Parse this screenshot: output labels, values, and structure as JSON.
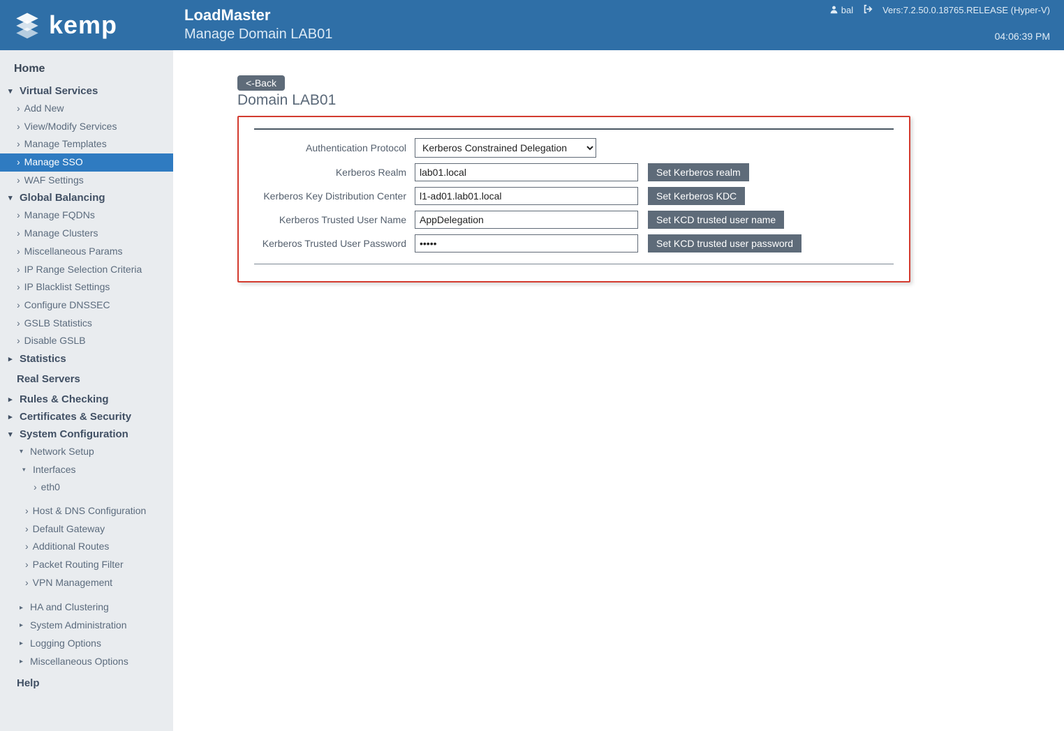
{
  "header": {
    "product": "LoadMaster",
    "subtitle": "Manage Domain LAB01",
    "user": "bal",
    "version": "Vers:7.2.50.0.18765.RELEASE (Hyper-V)",
    "clock": "04:06:39 PM",
    "logo_text": "kemp"
  },
  "sidebar": {
    "home": "Home",
    "virtual_services": {
      "label": "Virtual Services",
      "items": [
        "Add New",
        "View/Modify Services",
        "Manage Templates",
        "Manage SSO",
        "WAF Settings"
      ],
      "active_index": 3
    },
    "global_balancing": {
      "label": "Global Balancing",
      "items": [
        "Manage FQDNs",
        "Manage Clusters",
        "Miscellaneous Params",
        "IP Range Selection Criteria",
        "IP Blacklist Settings",
        "Configure DNSSEC",
        "GSLB Statistics",
        "Disable GSLB"
      ]
    },
    "statistics": "Statistics",
    "real_servers": "Real Servers",
    "rules_checking": "Rules & Checking",
    "certs_security": "Certificates & Security",
    "system_configuration": {
      "label": "System Configuration",
      "network_setup": {
        "label": "Network Setup",
        "interfaces": {
          "label": "Interfaces",
          "items": [
            "eth0"
          ]
        },
        "items": [
          "Host & DNS Configuration",
          "Default Gateway",
          "Additional Routes",
          "Packet Routing Filter",
          "VPN Management"
        ]
      },
      "collapsed": [
        "HA and Clustering",
        "System Administration",
        "Logging Options",
        "Miscellaneous Options"
      ]
    },
    "help": "Help"
  },
  "content": {
    "back_label": "<-Back",
    "domain_title": "Domain LAB01",
    "rows": {
      "auth_protocol": {
        "label": "Authentication Protocol",
        "value": "Kerberos Constrained Delegation"
      },
      "realm": {
        "label": "Kerberos Realm",
        "value": "lab01.local",
        "button": "Set Kerberos realm"
      },
      "kdc": {
        "label": "Kerberos Key Distribution Center",
        "value": "l1-ad01.lab01.local",
        "button": "Set Kerberos KDC"
      },
      "trusted_user": {
        "label": "Kerberos Trusted User Name",
        "value": "AppDelegation",
        "button": "Set KCD trusted user name"
      },
      "trusted_pass": {
        "label": "Kerberos Trusted User Password",
        "value": "•••••",
        "button": "Set KCD trusted user password"
      }
    }
  }
}
